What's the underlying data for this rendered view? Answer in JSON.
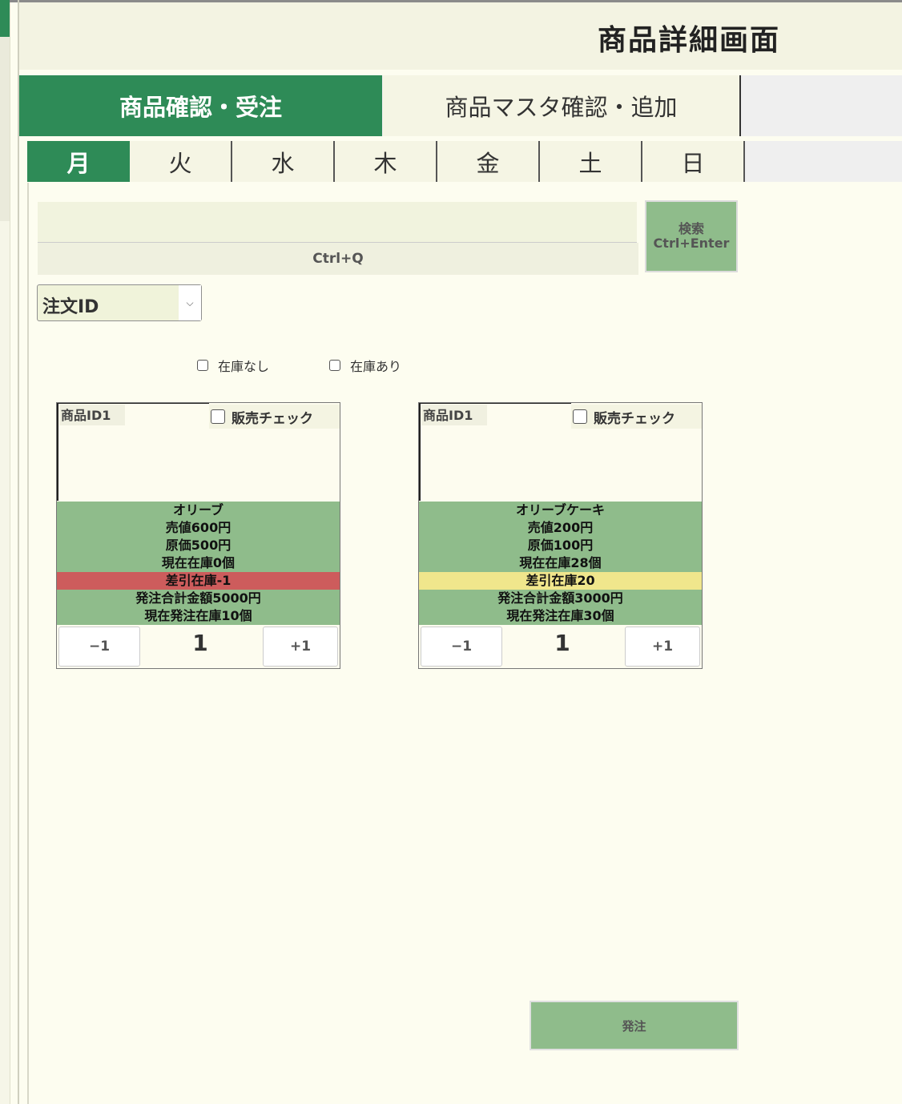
{
  "header": {
    "title": "商品詳細画面"
  },
  "tabs": [
    {
      "label": "商品確認・受注",
      "active": true
    },
    {
      "label": "商品マスタ確認・追加",
      "active": false
    }
  ],
  "days": [
    {
      "label": "月",
      "active": true
    },
    {
      "label": "火",
      "active": false
    },
    {
      "label": "水",
      "active": false
    },
    {
      "label": "木",
      "active": false
    },
    {
      "label": "金",
      "active": false
    },
    {
      "label": "土",
      "active": false
    },
    {
      "label": "日",
      "active": false
    }
  ],
  "search": {
    "value": "",
    "hint": "Ctrl+Q",
    "button_line1": "検索",
    "button_line2": "Ctrl+Enter"
  },
  "sort_select": {
    "value": "注文ID"
  },
  "filters": {
    "no_stock": {
      "label": "在庫なし",
      "checked": false
    },
    "in_stock": {
      "label": "在庫あり",
      "checked": false
    }
  },
  "cards": [
    {
      "id_label": "商品ID1",
      "sale_check_label": "販売チェック",
      "sale_checked": false,
      "name": "オリーブ",
      "price": "売値600円",
      "cost": "原価500円",
      "current_stock": "現在在庫0個",
      "diff_stock": "差引在庫-1",
      "diff_color": "#cd5c5c",
      "order_total": "発注合計金額5000円",
      "order_stock": "現在発注在庫10個",
      "minus_label": "−1",
      "quantity": "1",
      "plus_label": "+1"
    },
    {
      "id_label": "商品ID1",
      "sale_check_label": "販売チェック",
      "sale_checked": false,
      "name": "オリーブケーキ",
      "price": "売値200円",
      "cost": "原価100円",
      "current_stock": "現在在庫28個",
      "diff_stock": "差引在庫20",
      "diff_color": "#f0e68c",
      "order_total": "発注合計金額3000円",
      "order_stock": "現在発注在庫30個",
      "minus_label": "−1",
      "quantity": "1",
      "plus_label": "+1"
    }
  ],
  "order_button": {
    "label": "発注"
  },
  "colors": {
    "accent": "#2e8b57",
    "panel_green": "#8fbc8b",
    "background": "#fdfdf0"
  }
}
